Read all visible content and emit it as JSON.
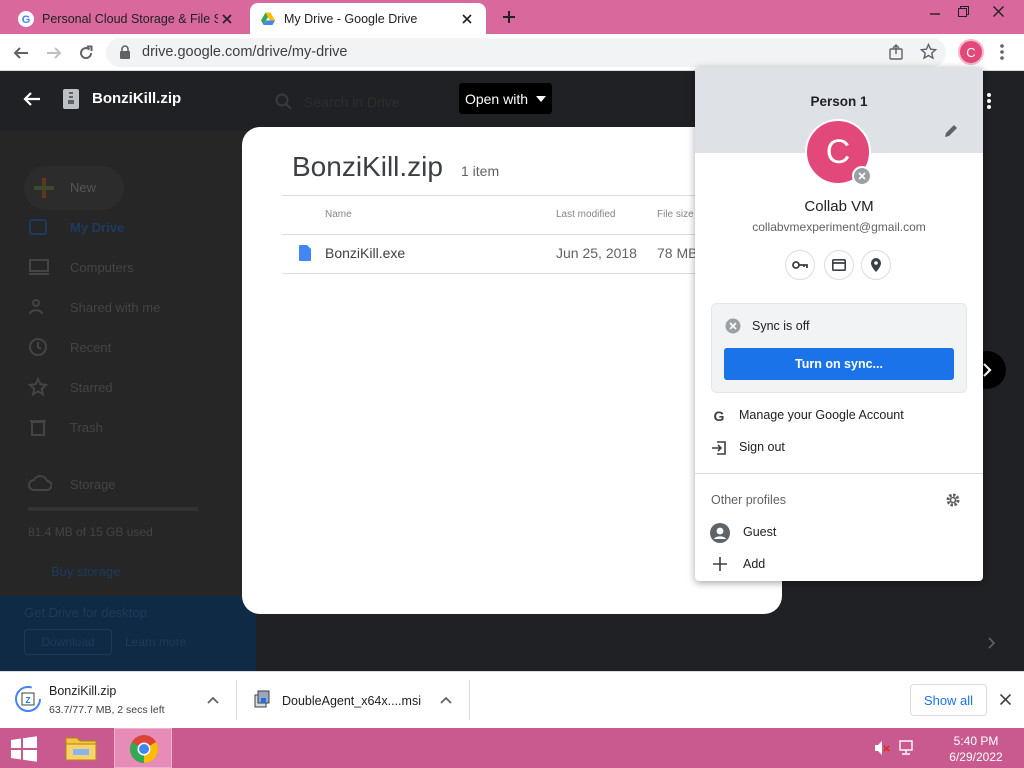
{
  "browser": {
    "tabs": [
      {
        "title": "Personal Cloud Storage & File Sh",
        "active": false
      },
      {
        "title": "My Drive - Google Drive",
        "active": true
      }
    ],
    "url": "drive.google.com/drive/my-drive",
    "profile_initial": "C"
  },
  "drive": {
    "file_title": "BonziKill.zip",
    "open_with_label": "Open with",
    "search_placeholder": "Search in Drive",
    "sidebar": {
      "new_label": "New",
      "items": [
        "My Drive",
        "Computers",
        "Shared with me",
        "Recent",
        "Starred",
        "Trash",
        "Storage"
      ],
      "storage_text": "81.4 MB of 15 GB used",
      "buy_storage": "Buy storage",
      "banner_title": "Get Drive for desktop",
      "banner_download": "Download",
      "banner_learn": "Learn more"
    },
    "zip_viewer": {
      "name": "BonziKill.zip",
      "count": "1 item",
      "columns": [
        "Name",
        "Last modified",
        "File size"
      ],
      "rows": [
        {
          "name": "BonziKill.exe",
          "modified": "Jun 25, 2018",
          "size": "78 MB"
        }
      ]
    }
  },
  "profile_menu": {
    "header": "Person 1",
    "initial": "C",
    "account_name": "Collab VM",
    "email": "collabvmexperiment@gmail.com",
    "sync_status": "Sync is off",
    "sync_button": "Turn on sync...",
    "manage_account": "Manage your Google Account",
    "sign_out": "Sign out",
    "other_profiles": "Other profiles",
    "guest": "Guest",
    "add": "Add"
  },
  "downloads": [
    {
      "name": "BonziKill.zip",
      "status": "63.7/77.7 MB, 2 secs left"
    },
    {
      "name": "DoubleAgent_x64x....msi",
      "status": ""
    }
  ],
  "downloads_show_all": "Show all",
  "taskbar": {
    "time": "5:40 PM",
    "date": "6/29/2022"
  },
  "colors": {
    "tab_strip": "#d9689c",
    "taskbar": "#c85a8f",
    "avatar": "#e2487a",
    "sync_button": "#1a73e8"
  }
}
